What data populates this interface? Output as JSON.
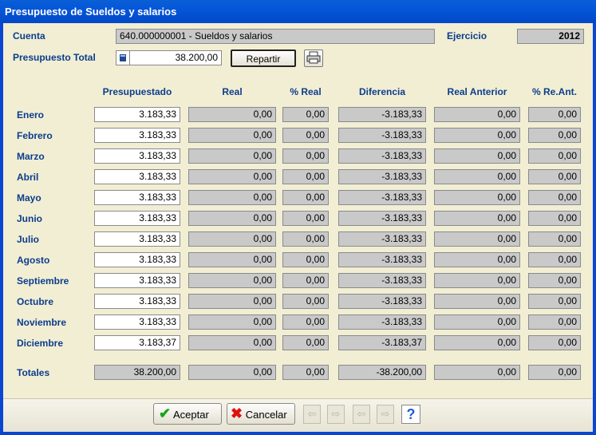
{
  "window": {
    "title": "Presupuesto de Sueldos y salarios"
  },
  "header": {
    "cuenta_label": "Cuenta",
    "cuenta_value": "640.000000001 - Sueldos y salarios",
    "ejercicio_label": "Ejercicio",
    "ejercicio_value": "2012",
    "total_label": "Presupuesto Total",
    "total_value": "38.200,00",
    "repartir_label": "Repartir"
  },
  "columns": [
    "Presupuestado",
    "Real",
    "% Real",
    "Diferencia",
    "Real Anterior",
    "% Re.Ant."
  ],
  "rows": [
    {
      "month": "Enero",
      "presupuestado": "3.183,33",
      "real": "0,00",
      "pct_real": "0,00",
      "diferencia": "-3.183,33",
      "real_anterior": "0,00",
      "pct_ant": "0,00"
    },
    {
      "month": "Febrero",
      "presupuestado": "3.183,33",
      "real": "0,00",
      "pct_real": "0,00",
      "diferencia": "-3.183,33",
      "real_anterior": "0,00",
      "pct_ant": "0,00"
    },
    {
      "month": "Marzo",
      "presupuestado": "3.183,33",
      "real": "0,00",
      "pct_real": "0,00",
      "diferencia": "-3.183,33",
      "real_anterior": "0,00",
      "pct_ant": "0,00"
    },
    {
      "month": "Abril",
      "presupuestado": "3.183,33",
      "real": "0,00",
      "pct_real": "0,00",
      "diferencia": "-3.183,33",
      "real_anterior": "0,00",
      "pct_ant": "0,00"
    },
    {
      "month": "Mayo",
      "presupuestado": "3.183,33",
      "real": "0,00",
      "pct_real": "0,00",
      "diferencia": "-3.183,33",
      "real_anterior": "0,00",
      "pct_ant": "0,00"
    },
    {
      "month": "Junio",
      "presupuestado": "3.183,33",
      "real": "0,00",
      "pct_real": "0,00",
      "diferencia": "-3.183,33",
      "real_anterior": "0,00",
      "pct_ant": "0,00"
    },
    {
      "month": "Julio",
      "presupuestado": "3.183,33",
      "real": "0,00",
      "pct_real": "0,00",
      "diferencia": "-3.183,33",
      "real_anterior": "0,00",
      "pct_ant": "0,00"
    },
    {
      "month": "Agosto",
      "presupuestado": "3.183,33",
      "real": "0,00",
      "pct_real": "0,00",
      "diferencia": "-3.183,33",
      "real_anterior": "0,00",
      "pct_ant": "0,00"
    },
    {
      "month": "Septiembre",
      "presupuestado": "3.183,33",
      "real": "0,00",
      "pct_real": "0,00",
      "diferencia": "-3.183,33",
      "real_anterior": "0,00",
      "pct_ant": "0,00"
    },
    {
      "month": "Octubre",
      "presupuestado": "3.183,33",
      "real": "0,00",
      "pct_real": "0,00",
      "diferencia": "-3.183,33",
      "real_anterior": "0,00",
      "pct_ant": "0,00"
    },
    {
      "month": "Noviembre",
      "presupuestado": "3.183,33",
      "real": "0,00",
      "pct_real": "0,00",
      "diferencia": "-3.183,33",
      "real_anterior": "0,00",
      "pct_ant": "0,00"
    },
    {
      "month": "Diciembre",
      "presupuestado": "3.183,37",
      "real": "0,00",
      "pct_real": "0,00",
      "diferencia": "-3.183,37",
      "real_anterior": "0,00",
      "pct_ant": "0,00"
    }
  ],
  "totals": {
    "label": "Totales",
    "presupuestado": "38.200,00",
    "real": "0,00",
    "pct_real": "0,00",
    "diferencia": "-38.200,00",
    "real_anterior": "0,00",
    "pct_ant": "0,00"
  },
  "footer": {
    "aceptar_label": "Aceptar",
    "cancelar_label": "Cancelar"
  },
  "colors": {
    "accent": "#0b3d8c",
    "title_bar": "#0556d8",
    "field_gray": "#c9c9c9"
  }
}
